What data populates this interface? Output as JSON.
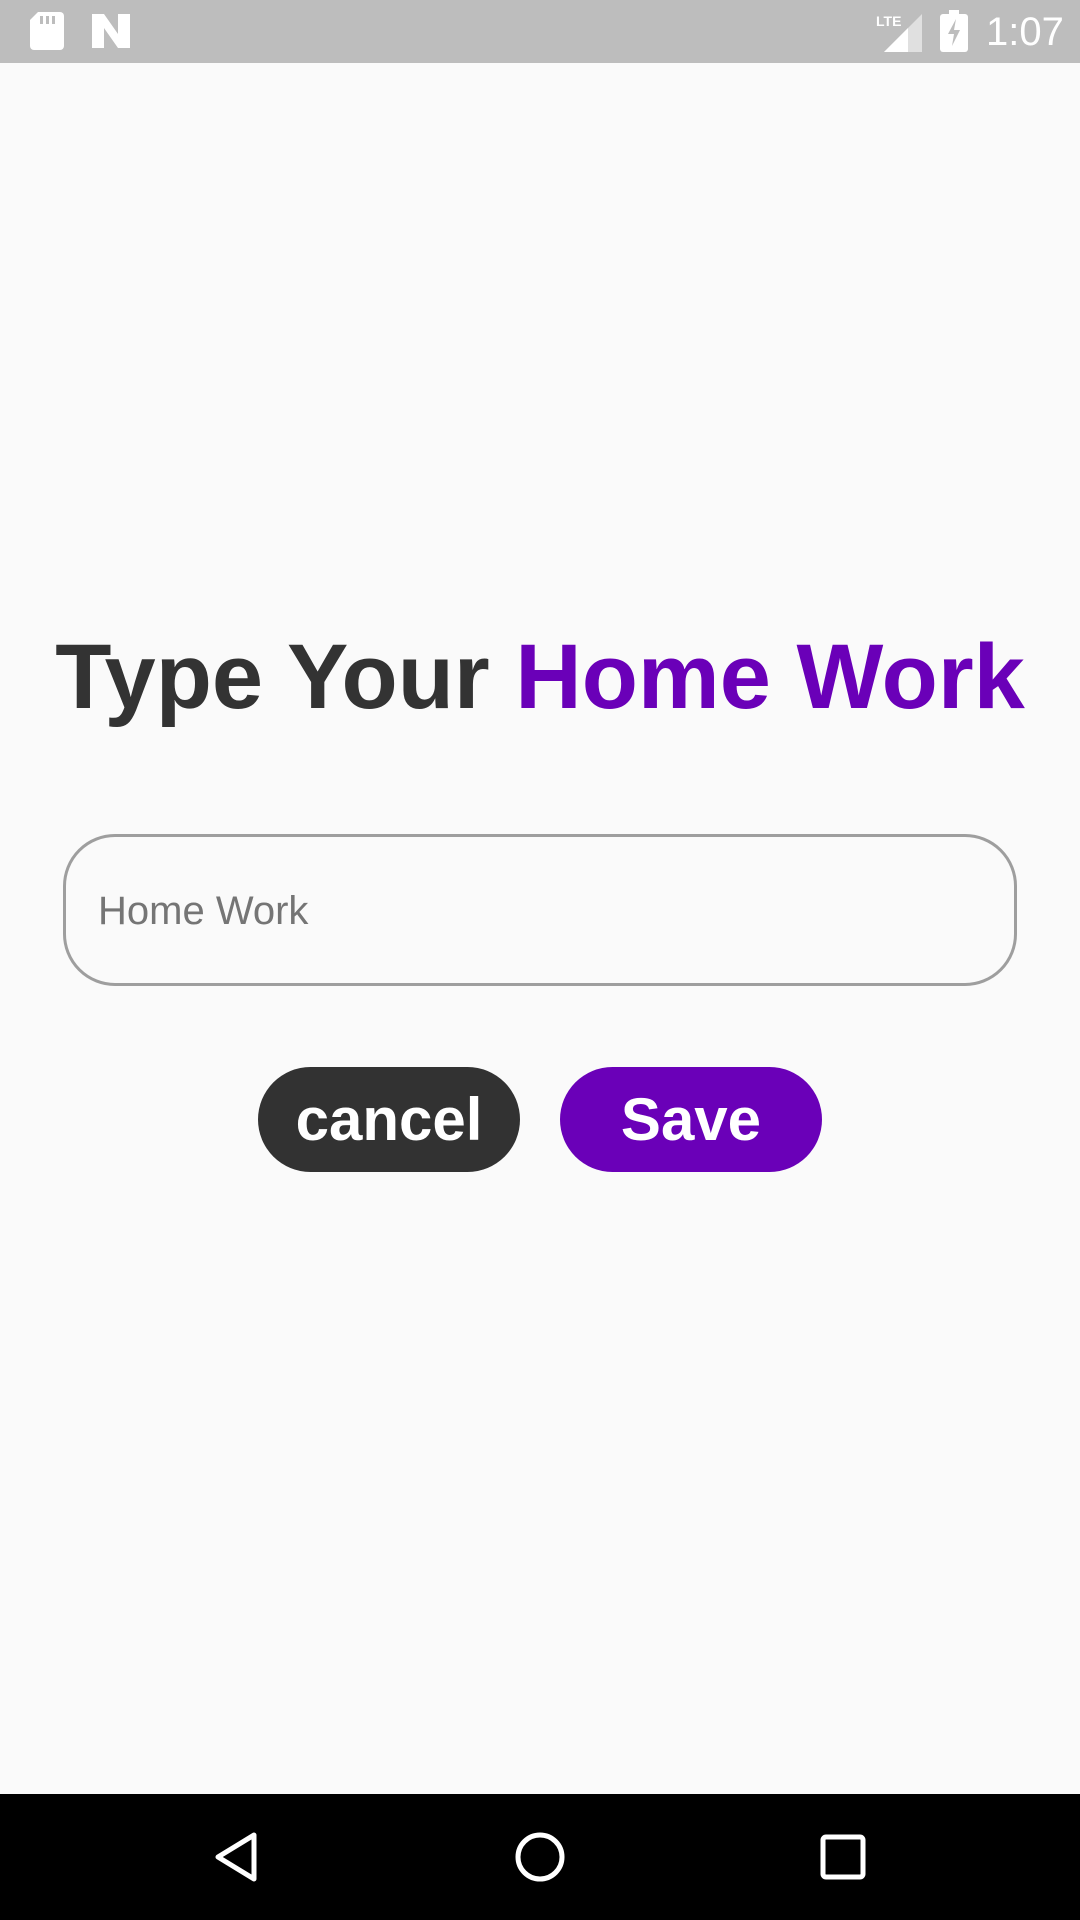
{
  "status_bar": {
    "time": "1:07",
    "network": "LTE",
    "icons": [
      "sd-card-icon",
      "n-notification-icon",
      "lte-signal-icon",
      "battery-charging-icon"
    ]
  },
  "title": {
    "part1": "Type Your ",
    "part2": "Home Work",
    "color_dark": "#333333",
    "color_accent": "#6a00b8"
  },
  "input": {
    "placeholder": "Home Work",
    "value": ""
  },
  "buttons": {
    "cancel_label": "cancel",
    "save_label": "Save",
    "cancel_color": "#323232",
    "save_color": "#6a00b8"
  },
  "nav_bar": {
    "icons": [
      "back-icon",
      "home-icon",
      "recent-apps-icon"
    ]
  }
}
